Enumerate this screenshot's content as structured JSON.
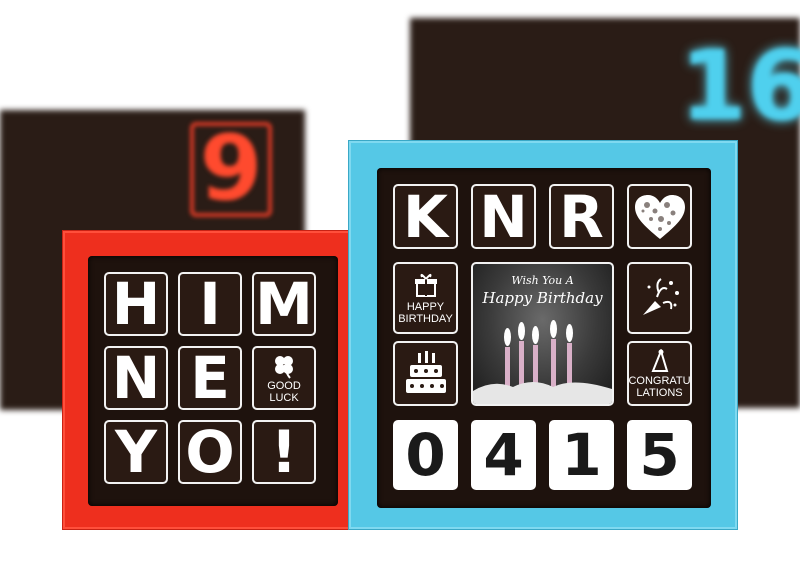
{
  "background": {
    "left_box_number": "9",
    "right_box_number": "16",
    "left_box_colors": {
      "box": "#2a1c16",
      "accent": "#ff4a2e"
    },
    "right_box_colors": {
      "box": "#2a1c16",
      "accent": "#4fd0ee"
    }
  },
  "red_box": {
    "frame_color": "#ee2f1e",
    "tiles": [
      {
        "row": 1,
        "text": [
          "H",
          "I",
          "M"
        ]
      },
      {
        "row": 2,
        "text": [
          "N",
          "E"
        ],
        "icon": "four-leaf-clover-icon",
        "icon_caption": "GOOD\nLUCK"
      },
      {
        "row": 3,
        "text": [
          "Y",
          "O",
          "!"
        ]
      }
    ]
  },
  "blue_box": {
    "frame_color": "#55c8e6",
    "top_letters": [
      "K",
      "N",
      "R"
    ],
    "heart_icon": "heart-icon",
    "gift_tile": {
      "icon": "gift-icon",
      "caption": "HAPPY\nBIRTHDAY"
    },
    "photo_tile": {
      "line1": "Wish You A",
      "line2": "Happy Birthday"
    },
    "party_tile": {
      "icon": "party-popper-icon"
    },
    "cake_tile": {
      "icon": "cake-icon"
    },
    "congrats_tile": {
      "icon": "party-hat-icon",
      "caption": "CONGRATU\nLATIONS"
    },
    "digits": [
      "0",
      "4",
      "1",
      "5"
    ]
  }
}
